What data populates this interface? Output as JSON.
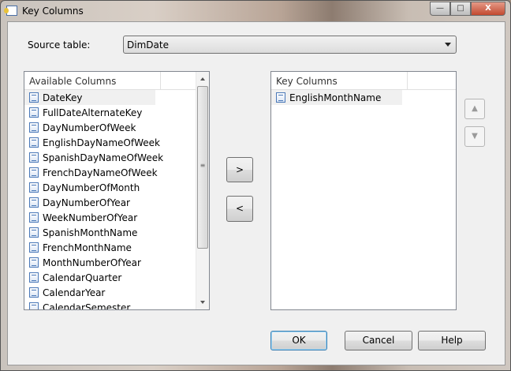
{
  "window": {
    "title": "Key Columns"
  },
  "source_table": {
    "label": "Source table:",
    "value": "DimDate"
  },
  "available": {
    "header": "Available Columns",
    "items": [
      "DateKey",
      "FullDateAlternateKey",
      "DayNumberOfWeek",
      "EnglishDayNameOfWeek",
      "SpanishDayNameOfWeek",
      "FrenchDayNameOfWeek",
      "DayNumberOfMonth",
      "DayNumberOfYear",
      "WeekNumberOfYear",
      "SpanishMonthName",
      "FrenchMonthName",
      "MonthNumberOfYear",
      "CalendarQuarter",
      "CalendarYear",
      "CalendarSemester"
    ]
  },
  "key": {
    "header": "Key Columns",
    "items": [
      "EnglishMonthName"
    ]
  },
  "buttons": {
    "add": ">",
    "remove": "<",
    "ok": "OK",
    "cancel": "Cancel",
    "help": "Help",
    "up": "▲",
    "down": "▼"
  }
}
